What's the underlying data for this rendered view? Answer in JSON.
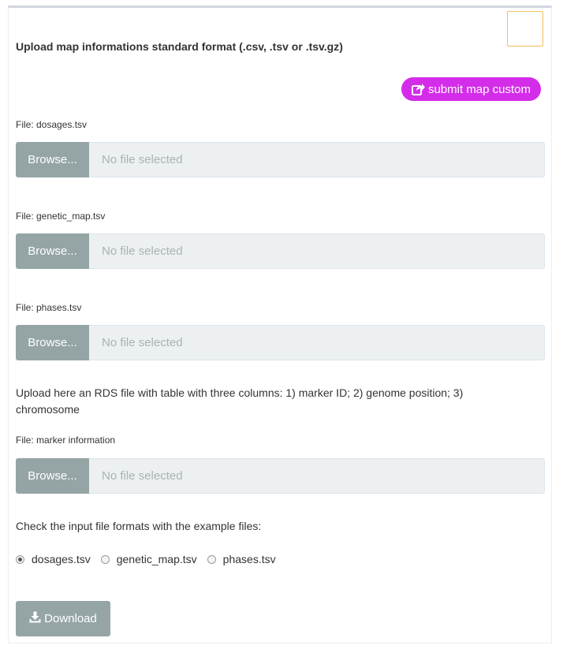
{
  "heading": "Upload map informations standard format (.csv, .tsv or .tsv.gz)",
  "submit_button": {
    "label": "submit map custom",
    "icon": "share-square-icon",
    "color": "#d42dea"
  },
  "uploads": [
    {
      "label": "File: dosages.tsv",
      "button": "Browse...",
      "placeholder": "No file selected"
    },
    {
      "label": "File: genetic_map.tsv",
      "button": "Browse...",
      "placeholder": "No file selected"
    },
    {
      "label": "File: phases.tsv",
      "button": "Browse...",
      "placeholder": "No file selected"
    },
    {
      "label": "File: marker information",
      "button": "Browse...",
      "placeholder": "No file selected"
    }
  ],
  "rds_instruction": "Upload here an RDS file with table with three columns: 1) marker ID; 2) genome position; 3) chromosome",
  "example_instruction": "Check the input file formats with the example files:",
  "example_options": [
    {
      "label": "dosages.tsv",
      "checked": true
    },
    {
      "label": "genetic_map.tsv",
      "checked": false
    },
    {
      "label": "phases.tsv",
      "checked": false
    }
  ],
  "download_button": {
    "label": "Download",
    "icon": "download-icon"
  },
  "colors": {
    "browse": "#95a5a6",
    "file_field": "#ecf0f1",
    "accent": "#d42dea",
    "corner_box_border": "#f0c060"
  }
}
